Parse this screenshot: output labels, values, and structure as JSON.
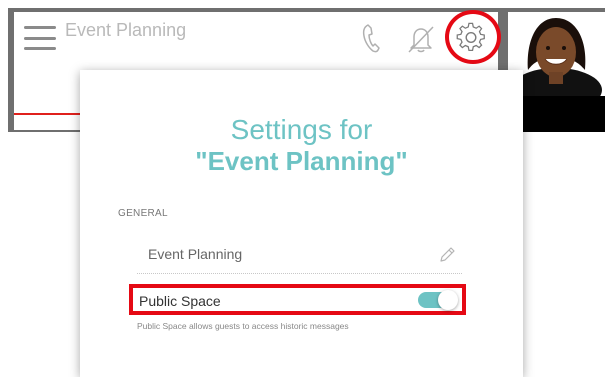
{
  "header": {
    "space_title": "Event Planning",
    "icons": [
      "menu-icon",
      "phone-icon",
      "bell-off-icon",
      "gear-icon"
    ],
    "highlight_color": "#e50914"
  },
  "settings": {
    "title": "Settings for",
    "subtitle": "\"Event Planning\"",
    "section_label": "GENERAL",
    "space_name_value": "Event Planning",
    "public_space_label": "Public Space",
    "public_space_enabled": true,
    "public_space_help": "Public Space allows guests to access historic messages",
    "accent_color": "#6dc3c4"
  }
}
